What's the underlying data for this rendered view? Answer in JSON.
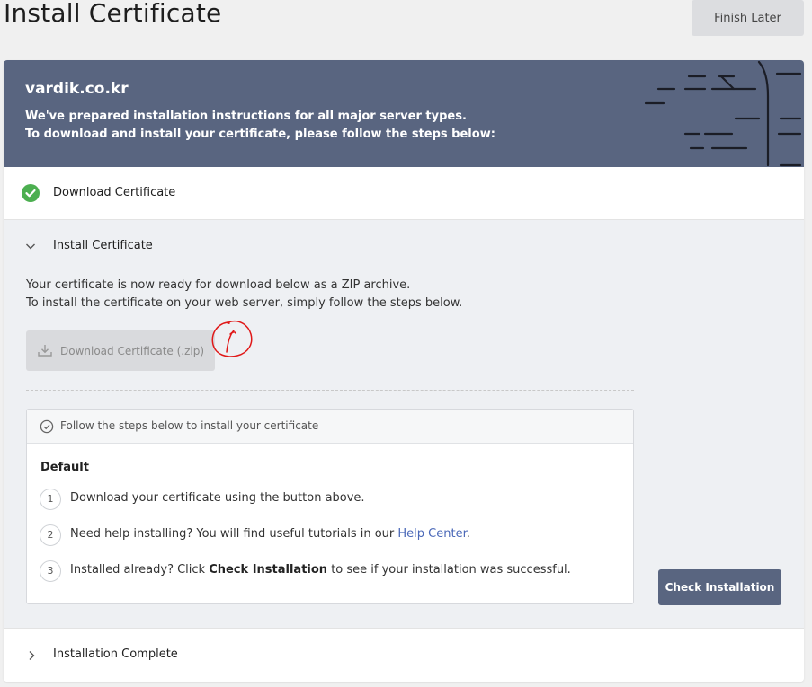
{
  "header": {
    "title": "Install Certificate",
    "finish_later_label": "Finish Later"
  },
  "banner": {
    "domain": "vardik.co.kr",
    "line1": "We've prepared installation instructions for all major server types.",
    "line2": "To download and install your certificate, please follow the steps below:",
    "color": "#596580"
  },
  "steps": {
    "download": {
      "label": "Download Certificate",
      "status": "completed",
      "icon": "check-circle-icon",
      "color": "#4caf50"
    },
    "install": {
      "label": "Install Certificate",
      "expanded": true,
      "desc_line1": "Your certificate is now ready for download below as a ZIP archive.",
      "desc_line2": "To install the certificate on your web server, simply follow the steps below.",
      "download_button_label": "Download Certificate (.zip)",
      "instructions": {
        "header": "Follow the steps below to install your certificate",
        "default_label": "Default",
        "items": [
          {
            "number": "1",
            "text": "Download your certificate using the button above."
          },
          {
            "number": "2",
            "text_before": "Need help installing? You will find useful tutorials in our ",
            "link": "Help Center",
            "text_after": "."
          },
          {
            "number": "3",
            "text_before": "Installed already? Click ",
            "bold": "Check Installation",
            "text_after": " to see if your installation was successful."
          }
        ]
      },
      "check_installation_label": "Check Installation"
    },
    "complete": {
      "label": "Installation Complete",
      "expanded": false
    }
  }
}
